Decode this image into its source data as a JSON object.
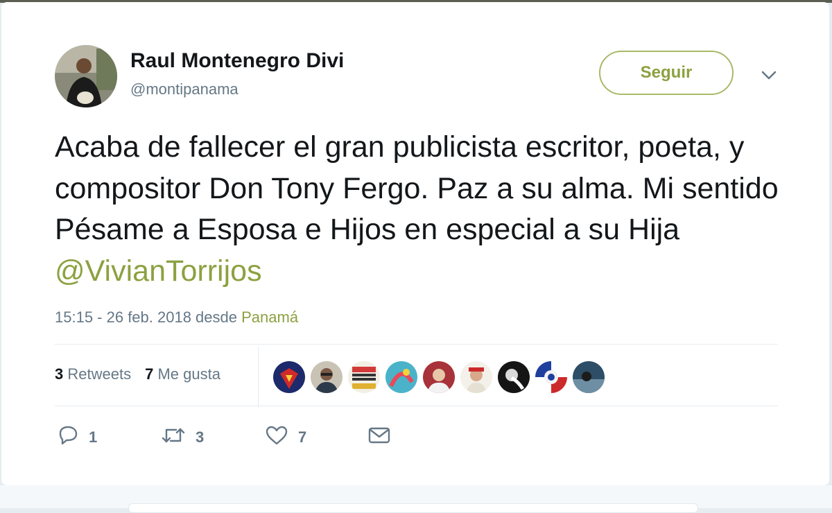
{
  "author": {
    "name": "Raul Montenegro Divi",
    "handle": "@montipanama"
  },
  "follow_label": "Seguir",
  "tweet": {
    "text": "Acaba de fallecer el gran publicista escritor, poeta, y compositor Don Tony Fergo. Paz a su alma. Mi sentido Pésame a Esposa e Hijos en especial a su Hija ",
    "mention": "@VivianTorrijos"
  },
  "meta": {
    "datetime": "15:15 - 26 feb. 2018",
    "from_word": " desde ",
    "place": "Panamá"
  },
  "stats": {
    "retweets_count": "3",
    "retweets_label": "Retweets",
    "likes_count": "7",
    "likes_label": "Me gusta"
  },
  "likers_count": 9,
  "actions": {
    "reply_count": "1",
    "retweet_count": "3",
    "like_count": "7"
  },
  "colors": {
    "accent": "#8ca140",
    "text": "#14171a",
    "secondary": "#657786"
  },
  "icons": [
    "reply-icon",
    "retweet-icon",
    "heart-icon",
    "envelope-icon",
    "chevron-down-icon"
  ]
}
